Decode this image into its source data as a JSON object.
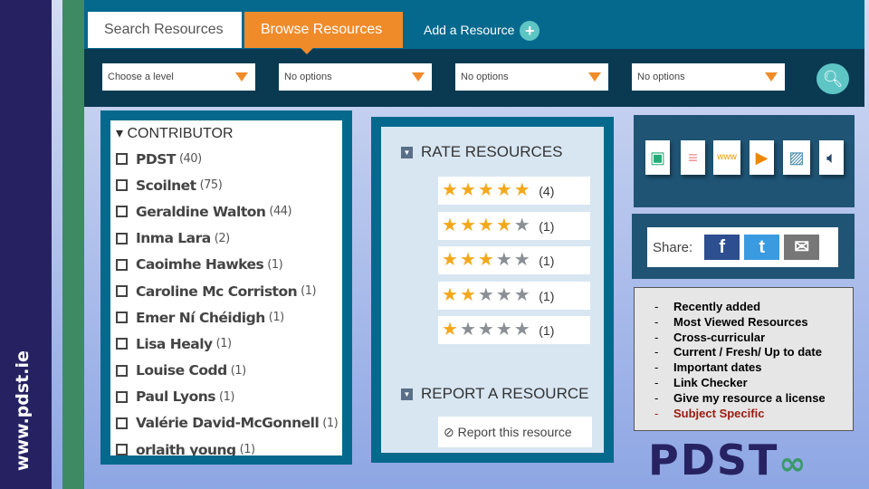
{
  "sidebar": {
    "url": "www.pdst.ie"
  },
  "tabs": {
    "search": "Search Resources",
    "browse": "Browse Resources",
    "add": "Add a Resource",
    "add_icon": "+"
  },
  "filters": [
    "Choose a level",
    "No options",
    "No options",
    "No options"
  ],
  "contributor": {
    "heading": "CONTRIBUTOR",
    "items": [
      {
        "name": "PDST",
        "count": "(40)"
      },
      {
        "name": "Scoilnet",
        "count": "(75)"
      },
      {
        "name": "Geraldine Walton",
        "count": "(44)"
      },
      {
        "name": "Inma Lara",
        "count": "(2)"
      },
      {
        "name": "Caoimhe Hawkes",
        "count": "(1)"
      },
      {
        "name": "Caroline Mc Corriston",
        "count": "(1)"
      },
      {
        "name": "Emer Ní Chéidigh",
        "count": "(1)"
      },
      {
        "name": "Lisa Healy",
        "count": "(1)"
      },
      {
        "name": "Louise Codd",
        "count": "(1)"
      },
      {
        "name": "Paul Lyons",
        "count": "(1)"
      },
      {
        "name": "Valérie David-McGonnell",
        "count": "(1)"
      },
      {
        "name": "orlaith young",
        "count": "(1)"
      }
    ]
  },
  "rate": {
    "heading": "RATE RESOURCES",
    "rows": [
      {
        "stars": 5,
        "count": "(4)"
      },
      {
        "stars": 4,
        "count": "(1)"
      },
      {
        "stars": 3,
        "count": "(1)"
      },
      {
        "stars": 2,
        "count": "(1)"
      },
      {
        "stars": 1,
        "count": "(1)"
      }
    ]
  },
  "report": {
    "heading": "REPORT A RESOURCE",
    "button": "⊘ Report this resource"
  },
  "share": {
    "label": "Share:",
    "facebook": "f",
    "twitter": "t",
    "email": "✉"
  },
  "features": {
    "items": [
      "Recently added",
      "Most Viewed Resources",
      "Cross-curricular",
      "Current / Fresh/ Up to date",
      "Important dates",
      "Link Checker",
      "Give my resource a license",
      "Subject Specific"
    ],
    "dash": "-"
  },
  "logo": "PDST",
  "colors": {
    "orange": "#f08b2a",
    "teal": "#04698d",
    "navy": "#262262"
  }
}
